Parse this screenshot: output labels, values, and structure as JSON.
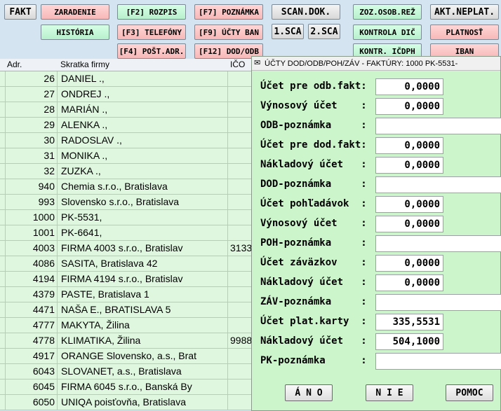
{
  "toolbar": {
    "fakt": "FAKT",
    "zaradenie": "ZARADENIE",
    "historia": "HISTÓRIA",
    "f2": "[F2] ROZPIS",
    "f3": "[F3] TELEFÓNY",
    "f4": "[F4] POŠT.ADR.",
    "f7": "[F7] POZNÁMKA",
    "f9": "[F9] ÚČTY BAN",
    "f12": "[F12] DOD/ODB",
    "scan": "SCAN.DOK.",
    "sca1": "1.SCA",
    "sca2": "2.SCA",
    "zoz": "ZOZ.OSOB.REŽ",
    "kontrola": "KONTROLA DIČ",
    "kontr_icdph": "KONTR. IČDPH",
    "akt": "AKT.NEPLAT.",
    "platnost": "PLATNOSŤ",
    "iban": "IBAN"
  },
  "table": {
    "headers": {
      "adr": "Adr.",
      "name": "Skratka firmy",
      "ico": "IČO"
    },
    "rows": [
      {
        "adr": "26",
        "name": "DANIEL  .,",
        "ico": ""
      },
      {
        "adr": "27",
        "name": "ONDREJ  .,",
        "ico": ""
      },
      {
        "adr": "28",
        "name": "MARIÁN  .,",
        "ico": ""
      },
      {
        "adr": "29",
        "name": "ALENKA  .,",
        "ico": ""
      },
      {
        "adr": "30",
        "name": "RADOSLAV  .,",
        "ico": ""
      },
      {
        "adr": "31",
        "name": "MONIKA  .,",
        "ico": ""
      },
      {
        "adr": "32",
        "name": "ZUZKA  .,",
        "ico": ""
      },
      {
        "adr": "940",
        "name": "Chemia s.r.o., Bratislava",
        "ico": ""
      },
      {
        "adr": "993",
        "name": "Slovensko s.r.o., Bratislava",
        "ico": ""
      },
      {
        "adr": "1000",
        "name": "PK-5531,",
        "ico": ""
      },
      {
        "adr": "1001",
        "name": "PK-6641,",
        "ico": ""
      },
      {
        "adr": "4003",
        "name": "FIRMA 4003 s.r.o., Bratislav",
        "ico": "3133"
      },
      {
        "adr": "4086",
        "name": "SASITA, Bratislava 42",
        "ico": ""
      },
      {
        "adr": "4194",
        "name": "FIRMA 4194 s.r.o., Bratislav",
        "ico": ""
      },
      {
        "adr": "4379",
        "name": "PASTE, Bratislava 1",
        "ico": ""
      },
      {
        "adr": "4471",
        "name": "NAŠA E., BRATISLAVA 5",
        "ico": ""
      },
      {
        "adr": "4777",
        "name": "MAKYTA, Žilina",
        "ico": ""
      },
      {
        "adr": "4778",
        "name": "KLIMATIKA, Žilina",
        "ico": "9988"
      },
      {
        "adr": "4917",
        "name": "ORANGE Slovensko, a.s., Brat",
        "ico": ""
      },
      {
        "adr": "6043",
        "name": "SLOVANET, a.s., Bratislava",
        "ico": ""
      },
      {
        "adr": "6045",
        "name": "FIRMA 6045 s.r.o., Banská By",
        "ico": ""
      },
      {
        "adr": "6050",
        "name": "UNIQA poisťovňa, Bratislava",
        "ico": ""
      }
    ]
  },
  "dialog": {
    "title": "ÚČTY DOD/ODB/POH/ZÁV - FAKTÚRY: 1000 PK-5531-",
    "fields": {
      "odb_ucet_label": "Účet pre odb.fakt:",
      "odb_ucet_value": "0,0000",
      "odb_vynos_label": "Výnosový účet    :",
      "odb_vynos_value": "0,0000",
      "odb_note_label": "ODB-poznámka     :",
      "dod_ucet_label": "Účet pre dod.fakt:",
      "dod_ucet_value": "0,0000",
      "dod_naklad_label": "Nákladový účet   :",
      "dod_naklad_value": "0,0000",
      "dod_note_label": "DOD-poznámka     :",
      "poh_ucet_label": "Účet pohľadávok  :",
      "poh_ucet_value": "0,0000",
      "poh_vynos_label": "Výnosový účet    :",
      "poh_vynos_value": "0,0000",
      "poh_note_label": "POH-poznámka     :",
      "zav_ucet_label": "Účet záväzkov    :",
      "zav_ucet_value": "0,0000",
      "zav_naklad_label": "Nákladový účet   :",
      "zav_naklad_value": "0,0000",
      "zav_note_label": "ZÁV-poznámka     :",
      "pk_ucet_label": "Účet plat.karty  :",
      "pk_ucet_value": "335,5531",
      "pk_naklad_label": "Nákladový účet   :",
      "pk_naklad_value": "504,1000",
      "pk_note_label": "PK-poznámka      :"
    },
    "buttons": {
      "ano": "Á N O",
      "nie": "N I E",
      "pomoc": "POMOC"
    }
  }
}
